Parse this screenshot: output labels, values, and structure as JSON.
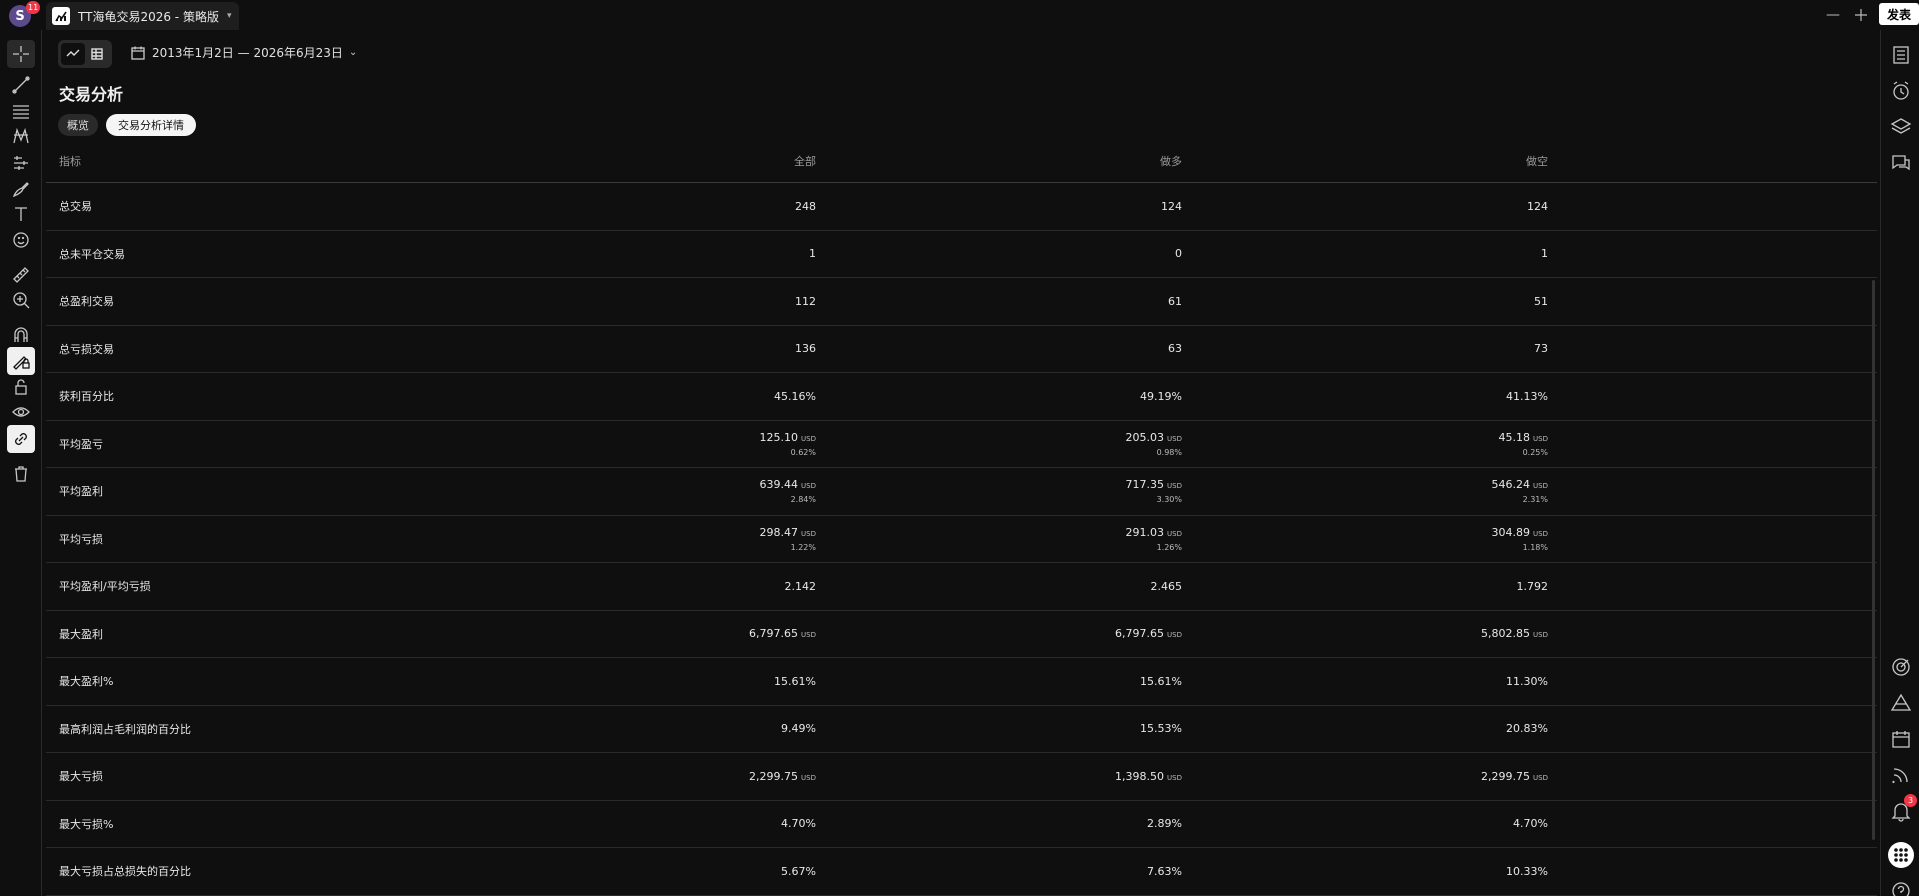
{
  "topbar": {
    "avatar_letter": "S",
    "avatar_badge": "11",
    "tab_title": "TT海龟交易2026 - 策略版",
    "publish_label": "发表"
  },
  "left_toolbar": [
    "crosshair-icon",
    "trend-line-icon",
    "fib-icon",
    "pattern-icon",
    "projection-icon",
    "brush-icon",
    "text-icon",
    "emoji-icon",
    "ruler-icon",
    "zoom-in-icon",
    "magnet-icon",
    "lock-drawing-icon",
    "unlock-icon",
    "eye-icon",
    "link-icon",
    "trash-icon"
  ],
  "right_toolbar": {
    "notifications_badge": "3"
  },
  "header": {
    "date_range": "2013年1月2日 — 2026年6月23日",
    "title": "交易分析",
    "tabs": [
      {
        "label": "概览"
      },
      {
        "label": "交易分析详情"
      }
    ]
  },
  "table": {
    "columns": [
      "指标",
      "全部",
      "做多",
      "做空"
    ],
    "rows": [
      {
        "label": "总交易",
        "all": {
          "v": "248"
        },
        "long": {
          "v": "124"
        },
        "short": {
          "v": "124"
        }
      },
      {
        "label": "总未平仓交易",
        "all": {
          "v": "1"
        },
        "long": {
          "v": "0"
        },
        "short": {
          "v": "1"
        }
      },
      {
        "label": "总盈利交易",
        "all": {
          "v": "112"
        },
        "long": {
          "v": "61"
        },
        "short": {
          "v": "51"
        }
      },
      {
        "label": "总亏损交易",
        "all": {
          "v": "136"
        },
        "long": {
          "v": "63"
        },
        "short": {
          "v": "73"
        }
      },
      {
        "label": "获利百分比",
        "all": {
          "v": "45.16%"
        },
        "long": {
          "v": "49.19%"
        },
        "short": {
          "v": "41.13%"
        }
      },
      {
        "label": "平均盈亏",
        "all": {
          "v": "125.10",
          "u": "USD",
          "s": "0.62%"
        },
        "long": {
          "v": "205.03",
          "u": "USD",
          "s": "0.98%"
        },
        "short": {
          "v": "45.18",
          "u": "USD",
          "s": "0.25%"
        }
      },
      {
        "label": "平均盈利",
        "all": {
          "v": "639.44",
          "u": "USD",
          "s": "2.84%"
        },
        "long": {
          "v": "717.35",
          "u": "USD",
          "s": "3.30%"
        },
        "short": {
          "v": "546.24",
          "u": "USD",
          "s": "2.31%"
        }
      },
      {
        "label": "平均亏损",
        "all": {
          "v": "298.47",
          "u": "USD",
          "s": "1.22%"
        },
        "long": {
          "v": "291.03",
          "u": "USD",
          "s": "1.26%"
        },
        "short": {
          "v": "304.89",
          "u": "USD",
          "s": "1.18%"
        }
      },
      {
        "label": "平均盈利/平均亏损",
        "all": {
          "v": "2.142"
        },
        "long": {
          "v": "2.465"
        },
        "short": {
          "v": "1.792"
        }
      },
      {
        "label": "最大盈利",
        "all": {
          "v": "6,797.65",
          "u": "USD"
        },
        "long": {
          "v": "6,797.65",
          "u": "USD"
        },
        "short": {
          "v": "5,802.85",
          "u": "USD"
        }
      },
      {
        "label": "最大盈利%",
        "all": {
          "v": "15.61%"
        },
        "long": {
          "v": "15.61%"
        },
        "short": {
          "v": "11.30%"
        }
      },
      {
        "label": "最高利润占毛利润的百分比",
        "all": {
          "v": "9.49%"
        },
        "long": {
          "v": "15.53%"
        },
        "short": {
          "v": "20.83%"
        }
      },
      {
        "label": "最大亏损",
        "all": {
          "v": "2,299.75",
          "u": "USD"
        },
        "long": {
          "v": "1,398.50",
          "u": "USD"
        },
        "short": {
          "v": "2,299.75",
          "u": "USD"
        }
      },
      {
        "label": "最大亏损%",
        "all": {
          "v": "4.70%"
        },
        "long": {
          "v": "2.89%"
        },
        "short": {
          "v": "4.70%"
        }
      },
      {
        "label": "最大亏损占总损失的百分比",
        "all": {
          "v": "5.67%"
        },
        "long": {
          "v": "7.63%"
        },
        "short": {
          "v": "10.33%"
        }
      }
    ]
  }
}
